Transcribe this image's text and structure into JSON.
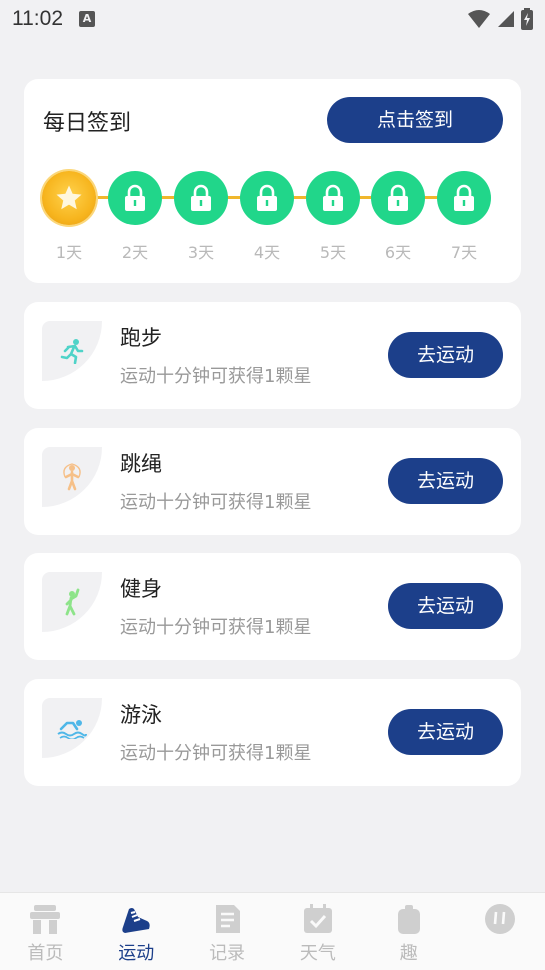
{
  "status_bar": {
    "time": "11:02",
    "notification_letter": "A"
  },
  "checkin": {
    "title": "每日签到",
    "button_label": "点击签到",
    "days": [
      {
        "label": "1天",
        "state": "done"
      },
      {
        "label": "2天",
        "state": "locked"
      },
      {
        "label": "3天",
        "state": "locked"
      },
      {
        "label": "4天",
        "state": "locked"
      },
      {
        "label": "5天",
        "state": "locked"
      },
      {
        "label": "6天",
        "state": "locked"
      },
      {
        "label": "7天",
        "state": "locked"
      }
    ]
  },
  "sports": [
    {
      "name": "跑步",
      "desc": "运动十分钟可获得1颗星",
      "button": "去运动",
      "icon": "running-icon",
      "icon_color": "#4fd3c8"
    },
    {
      "name": "跳绳",
      "desc": "运动十分钟可获得1颗星",
      "button": "去运动",
      "icon": "jump-rope-icon",
      "icon_color": "#f6c088"
    },
    {
      "name": "健身",
      "desc": "运动十分钟可获得1颗星",
      "button": "去运动",
      "icon": "fitness-icon",
      "icon_color": "#8ee48a"
    },
    {
      "name": "游泳",
      "desc": "运动十分钟可获得1颗星",
      "button": "去运动",
      "icon": "swimming-icon",
      "icon_color": "#4fb7e8"
    }
  ],
  "tabs": [
    {
      "label": "首页",
      "active": false
    },
    {
      "label": "运动",
      "active": true
    },
    {
      "label": "记录",
      "active": false
    },
    {
      "label": "天气",
      "active": false
    },
    {
      "label": "趣",
      "active": false
    },
    {
      "label": "",
      "active": false
    }
  ],
  "colors": {
    "primary": "#1c3f8a",
    "locked_day": "#21d68a",
    "done_day": "#f7b51e",
    "background": "#f1f1f3"
  }
}
